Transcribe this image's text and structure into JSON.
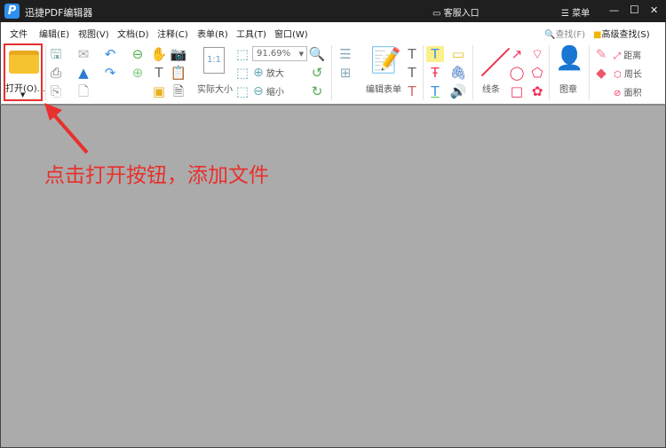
{
  "titlebar": {
    "app_title": "迅捷PDF编辑器",
    "support": "客服入口",
    "menu": "菜单",
    "minimize": "—",
    "maximize": "☐",
    "close": "✕"
  },
  "menubar": {
    "items": [
      "文件",
      "编辑(E)",
      "视图(V)",
      "文档(D)",
      "注释(C)",
      "表单(R)",
      "工具(T)",
      "窗口(W)"
    ],
    "find": "查找(F)",
    "advanced_find": "高级查找(S)"
  },
  "toolbar": {
    "open": "打开(O)...",
    "actual_size": "实际大小",
    "zoom_value": "91.69%",
    "zoom_in": "放大",
    "zoom_out": "缩小",
    "edit_form": "编辑表单",
    "line": "线条",
    "stamp": "图章",
    "distance": "距离",
    "perimeter": "周长",
    "area": "面积"
  },
  "annotation": {
    "instruction": "点击打开按钮，添加文件",
    "color": "#e8302c"
  }
}
